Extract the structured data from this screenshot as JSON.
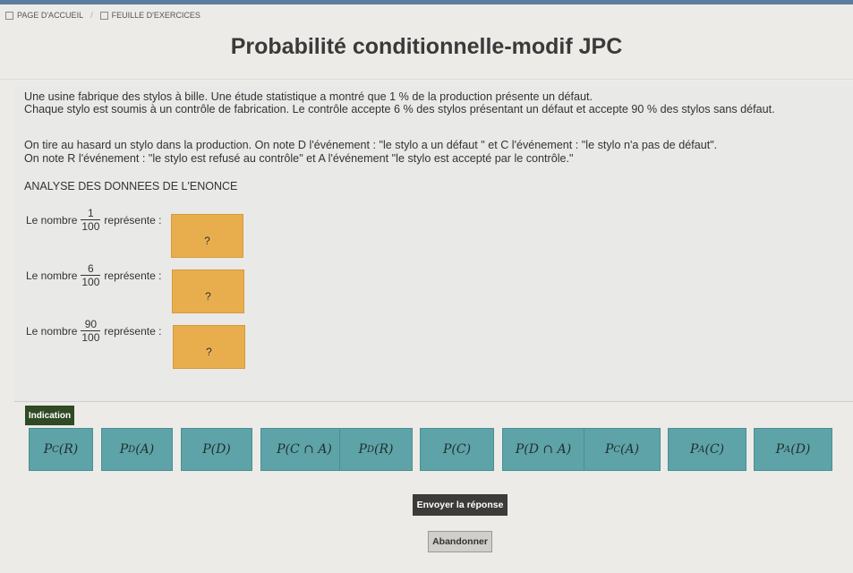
{
  "breadcrumb": {
    "home": "PAGE D'ACCUEIL",
    "exercises": "FEUILLE D'EXERCICES"
  },
  "page": {
    "title": "Probabilité conditionnelle-modif JPC"
  },
  "statement": {
    "line1": "Une usine fabrique des stylos à bille. Une étude statistique a montré que 1 % de la production présente un défaut.",
    "line2": "Chaque stylo est soumis à un contrôle de fabrication. Le contrôle accepte 6 % des stylos présentant un défaut et accepte 90 % des stylos sans défaut.",
    "line3": "On tire au hasard un stylo dans la production. On note D l'événement : \"le stylo a un défaut \" et C l'événement : \"le stylo n'a pas de défaut\".",
    "line4": "On note R l'événement : \"le stylo est refusé au contrôle\" et A l'événement \"le stylo est accepté par le contrôle.\""
  },
  "section_title": "ANALYSE DES DONNEES DE L'ENONCE",
  "questions": [
    {
      "prefix": "Le nombre",
      "num": "1",
      "den": "100",
      "suffix": "représente :",
      "answer": "?"
    },
    {
      "prefix": "Le nombre",
      "num": "6",
      "den": "100",
      "suffix": "représente :",
      "answer": "?"
    },
    {
      "prefix": "Le nombre",
      "num": "90",
      "den": "100",
      "suffix": "représente :",
      "answer": "?"
    }
  ],
  "indication_label": "Indication",
  "choices": [
    "P_C(R)",
    "P_D(A)",
    "P(D)",
    "P(C ∩ A)",
    "P_D(R)",
    "P(C)",
    "P(D ∩ A)",
    "P_C(A)",
    "P_A(C)",
    "P_A(D)"
  ],
  "buttons": {
    "send": "Envoyer la réponse",
    "abandon": "Abandonner"
  },
  "colors": {
    "drop_zone": "#e8ae4e",
    "choice": "#5ea3a7",
    "indication": "#2f4a25",
    "send": "#3d3b39"
  }
}
